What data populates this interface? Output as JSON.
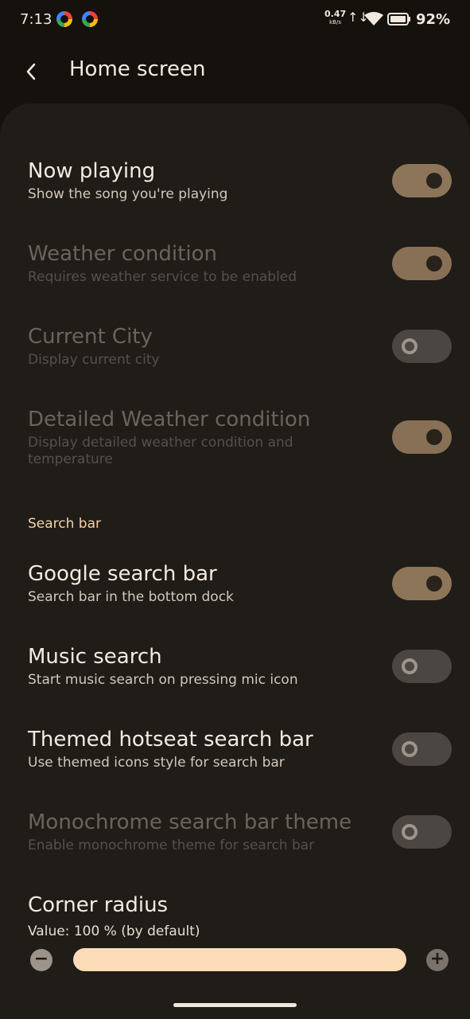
{
  "status_bar": {
    "time": "7:13",
    "net_speed_value": "0.47",
    "net_speed_unit": "kB/s",
    "battery_percent": "92%"
  },
  "header": {
    "title": "Home screen"
  },
  "settings": [
    {
      "title": "Now playing",
      "subtitle": "Show the song you're playing",
      "enabled": true,
      "on": true
    },
    {
      "title": "Weather condition",
      "subtitle": "Requires weather service to be enabled",
      "enabled": false,
      "on": true
    },
    {
      "title": "Current City",
      "subtitle": "Display current city",
      "enabled": false,
      "on": false
    },
    {
      "title": "Detailed Weather condition",
      "subtitle": "Display detailed weather condition and temperature",
      "enabled": false,
      "on": true
    }
  ],
  "search_section": {
    "header": "Search bar",
    "items": [
      {
        "title": "Google search bar",
        "subtitle": "Search bar in the bottom dock",
        "enabled": true,
        "on": true
      },
      {
        "title": "Music search",
        "subtitle": "Start music search on pressing mic icon",
        "enabled": true,
        "on": false
      },
      {
        "title": "Themed hotseat search bar",
        "subtitle": "Use themed icons style for search bar",
        "enabled": true,
        "on": false
      },
      {
        "title": "Monochrome search bar theme",
        "subtitle": "Enable monochrome theme for search bar",
        "enabled": false,
        "on": false
      }
    ]
  },
  "corner_radius": {
    "title": "Corner radius",
    "value_text": "Value: 100 % (by default)",
    "value_percent": 100,
    "minus_label": "−",
    "plus_label": "+"
  },
  "colors": {
    "background": "#15110d",
    "panel": "#201c18",
    "switch_on": "#8d7559",
    "switch_off": "#4b4641",
    "accent": "#fbdcb7"
  }
}
